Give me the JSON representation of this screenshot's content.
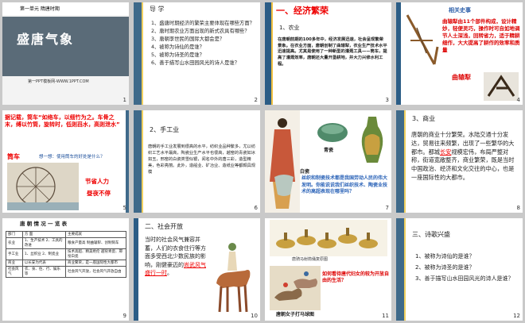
{
  "slides": [
    {
      "n": "1",
      "header": "第一单元 隋唐时期",
      "title": "盛唐气象",
      "site": "第一PPT模板网-WWW.1PPT.COM"
    },
    {
      "n": "2",
      "title": "导 学",
      "items": [
        "1、盛唐时期经济的繁荣主要体现在哪些方面？",
        "2、唐时期农业方面出现的新式农具有哪些？",
        "3、唐朝李世民的国际大都会是？",
        "4、被称为诗仙的是谁？",
        "5、被称为诗圣的是谁？",
        "6、善于描写山水田园风光的诗人是谁？"
      ]
    },
    {
      "n": "3",
      "title": "一、经济繁荣",
      "sub": "1、农业",
      "text": "在唐朝前期的100多年中，经济发展迅速，社会呈现繁荣景象。在农业方面，唐朝创制了曲辕犁，农业生产技术水平迅速提高。尤其是使用了一种新型的灌溉工具——筒车，提高了灌溉效率，唐朝还大量开垦耕地，并大力兴修水利工程。"
    },
    {
      "n": "4",
      "title": "相关史事",
      "text": "曲辕犁由11个部件构成，设计精妙，轻便灵巧，操作时可自如地调节人土深浅，回转省力，适于精耕细作，大大提高了耕作的效率和质量",
      "label": "曲辕犁"
    },
    {
      "n": "5",
      "text": "据记载，筒车“如络车，以细竹为之。车骨之末，缚以竹筒，旋转时，低则舀水，高则泄水”",
      "label": "筒车",
      "question": "想一想：使用筒车的好处是什么？",
      "a1": "节省人力",
      "a2": "昼夜不停"
    },
    {
      "n": "6",
      "title": "2、手工业",
      "text": "唐朝的手工业发展到很高的水平，纺织业品种繁多，尤以纺织工艺水平最高，陶瓷业生产水平也很高，越窑的青瓷如冰如玉，邢窑的白瓷类雪似银，闻名中外的唐三彩，造型精美，色彩亮丽。此外，造船业、矿冶业、造纸业等都颇具规模"
    },
    {
      "n": "7",
      "c1": "青瓷",
      "c2": "白瓷",
      "text": "丝织和制瓷技术都是我国劳动人民的伟大发明。你能说说我们丝织技术、陶瓷业技术的高超表现在哪里吗？"
    },
    {
      "n": "8",
      "title": "3、商业",
      "text_a": "唐朝的商业十分繁荣。水陆交通十分发达，贸易往来频繁，出现了一些繁华的大都市。都城",
      "link": "长安",
      "text_b": "规模宏伟，布局严整对称，街道宽敞整齐，商业繁荣，既是当时中国政治、经济和文化交往的中心，也是一座国际性的大都市。"
    },
    {
      "n": "9",
      "title": "唐 朝 情 况 一 览 表",
      "rows": [
        [
          "部门",
          "方 面",
          "主要成就"
        ],
        [
          "农业",
          "1、生产技术\n2、工具的改进",
          "粮食产量高\n制曲辕犁、创制筒车"
        ],
        [
          "手工业",
          "1、丝织业\n2、制瓷业",
          "技术高超、精美绝伦\n越窑青瓷、邢窑白瓷"
        ],
        [
          "商业",
          "以长安为代表",
          "商业繁荣，是一座国际性大都市"
        ],
        [
          "社会风气",
          "衣、食、住、行、娱乐等",
          "社会风气开放，社会风气开放自由"
        ]
      ]
    },
    {
      "n": "10",
      "title": "二、社会开放",
      "text_a": "当时的社会风气兼容并蓄，人们的衣食住行等方面多受西北少数民族的影响，刚健豪迈的",
      "link": "尚武风气盛行一时",
      "text_b": "。"
    },
    {
      "n": "11",
      "cap": "唐骑马射箭俑复原图",
      "question": "如何看待唐代妇女的较为开放自由的生活？",
      "cap2": "唐朝女子打马球图"
    },
    {
      "n": "12",
      "title": "三、诗歌兴盛",
      "items": [
        "1、被称为诗仙的是谁？",
        "2、被称为诗圣的是谁？",
        "3、善于描写山水田园风光的诗人是谁？"
      ]
    }
  ]
}
